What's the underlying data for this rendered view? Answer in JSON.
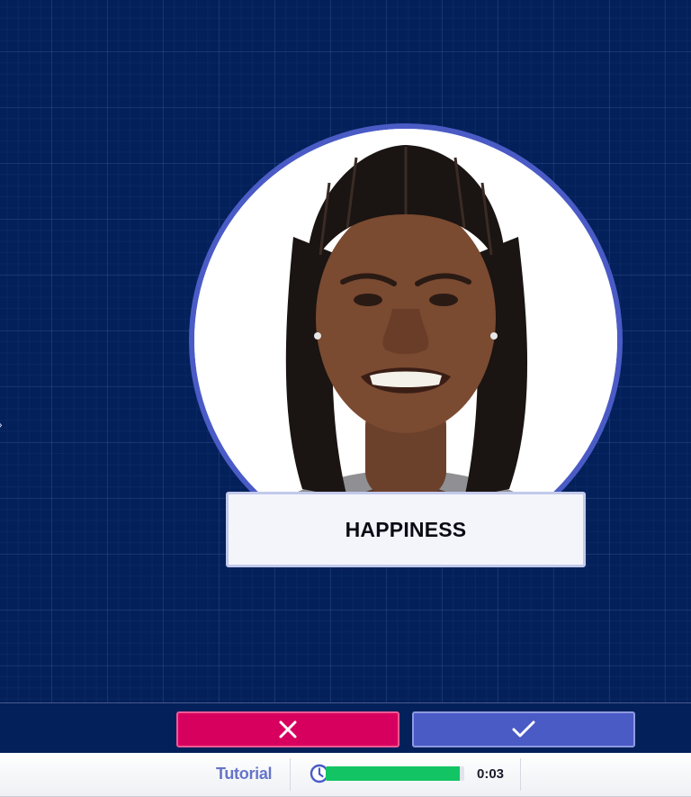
{
  "stage": {
    "background_color": "#03205a",
    "emotion_label": "HAPPINESS",
    "portrait_icon": "face-portrait-photo"
  },
  "actions": {
    "reject_icon": "close-icon",
    "accept_icon": "checkmark-icon",
    "reject_color": "#d7005f",
    "accept_color": "#4a5bc6"
  },
  "status": {
    "tutorial_label": "Tutorial",
    "timer_icon": "clock-icon",
    "timer_value": "0:03",
    "progress_fraction": 0.97,
    "progress_color": "#12c463"
  }
}
